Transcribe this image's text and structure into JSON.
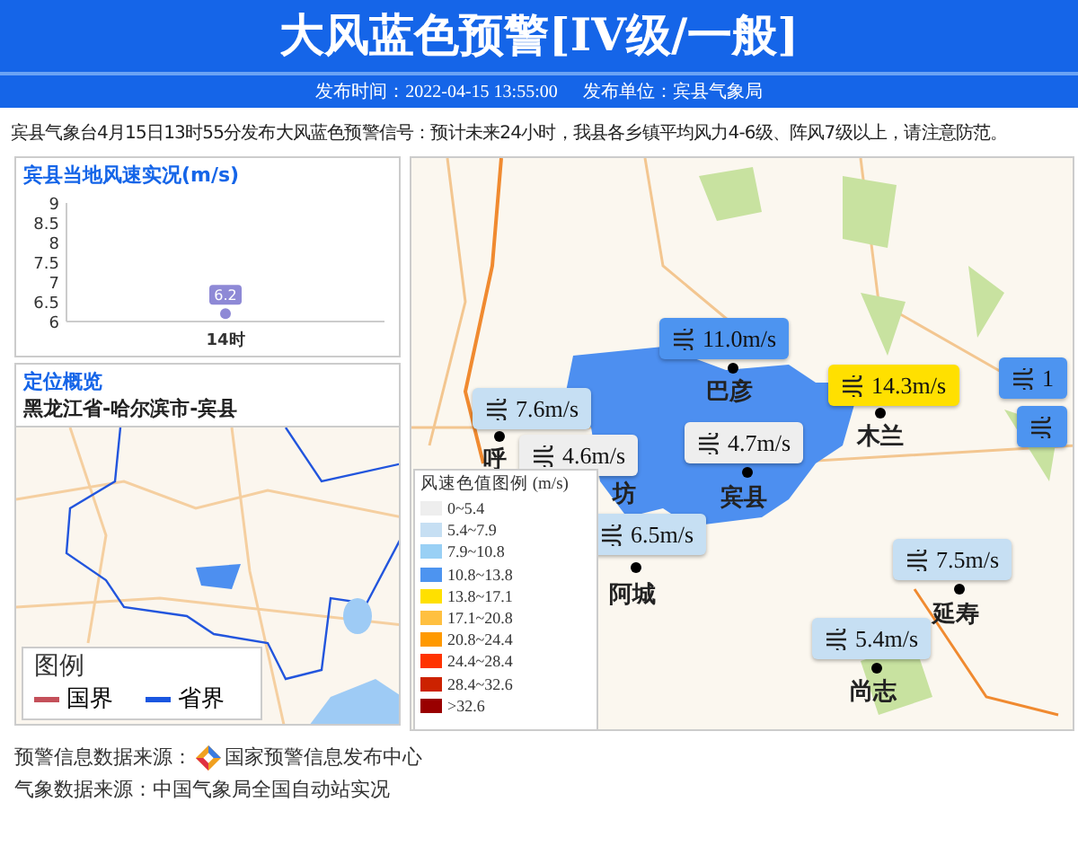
{
  "header": {
    "title": "大风蓝色预警[IV级/一般]",
    "publish_time": "发布时间：2022-04-15 13:55:00",
    "publisher": "发布单位：宾县气象局"
  },
  "description": "宾县气象台4月15日13时55分发布大风蓝色预警信号：预计未来24小时，我县各乡镇平均风力4-6级、阵风7级以上，请注意防范。",
  "wind_panel": {
    "title": "宾县当地风速实况(m/s)",
    "chart_data": {
      "type": "line",
      "categories": [
        "14时"
      ],
      "series": [
        {
          "color": "#8e89d6",
          "marker": true,
          "values": [
            6.2
          ]
        }
      ],
      "ylim": [
        6,
        9
      ],
      "yticks": [
        6,
        6.5,
        7,
        7.5,
        8,
        8.5,
        9
      ],
      "data_labels": true
    }
  },
  "location_panel": {
    "title": "定位概览",
    "region": "黑龙江省-哈尔滨市-宾县",
    "legend": {
      "title": "图例",
      "items": [
        {
          "label": "国界",
          "color": "#c4505a"
        },
        {
          "label": "省界",
          "color": "#1a56e0"
        }
      ]
    }
  },
  "map": {
    "stations": [
      {
        "value": "11.0m/s",
        "color": "#4d94f0"
      },
      {
        "value": "14.3m/s",
        "color": "#ffe000"
      },
      {
        "value": "1",
        "color": "#4d94f0"
      },
      {
        "color": "#4d94f0"
      },
      {
        "value": "7.6m/s",
        "color": "#c6dff3"
      },
      {
        "value": "4.6m/s",
        "color": "#eeeeee"
      },
      {
        "value": "4.7m/s",
        "color": "#eeeeee"
      },
      {
        "value": "6.5m/s",
        "color": "#c6dff3"
      },
      {
        "value": "7.5m/s",
        "color": "#c6dff3"
      },
      {
        "value": "5.4m/s",
        "color": "#c6dff3"
      }
    ],
    "places": [
      "巴彦",
      "木兰",
      "呼",
      "宾县",
      "坊",
      "阿城",
      "延寿",
      "尚志"
    ],
    "legend": {
      "title": "风速色值图例 (m/s)",
      "items": [
        {
          "label": "0~5.4",
          "color": "#eeeeee"
        },
        {
          "label": "5.4~7.9",
          "color": "#c6dff3"
        },
        {
          "label": "7.9~10.8",
          "color": "#99d0f5"
        },
        {
          "label": "10.8~13.8",
          "color": "#4d94f0"
        },
        {
          "label": "13.8~17.1",
          "color": "#ffe000"
        },
        {
          "label": "17.1~20.8",
          "color": "#ffc040"
        },
        {
          "label": "20.8~24.4",
          "color": "#ff9900"
        },
        {
          "label": "24.4~28.4",
          "color": "#ff3300"
        },
        {
          "label": "28.4~32.6",
          "color": "#cc2200"
        },
        {
          "label": ">32.6",
          "color": "#990000"
        }
      ]
    }
  },
  "footer": {
    "warning_source": "预警信息数据来源：",
    "warning_source_name": "国家预警信息发布中心",
    "weather_source": "气象数据来源：中国气象局全国自动站实况"
  }
}
